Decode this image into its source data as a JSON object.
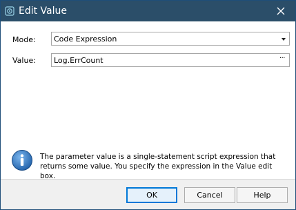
{
  "window": {
    "title": "Edit Value",
    "accent": "#2b4e69"
  },
  "form": {
    "mode_label": "Mode:",
    "mode_value": "Code Expression",
    "value_label": "Value:",
    "value_value": "Log.ErrCount",
    "ellipsis": "···"
  },
  "info": {
    "text": "The parameter value is a single-statement script expression that returns some value. You specify the expression in the Value edit box."
  },
  "buttons": {
    "ok": "OK",
    "cancel": "Cancel",
    "help": "Help"
  }
}
